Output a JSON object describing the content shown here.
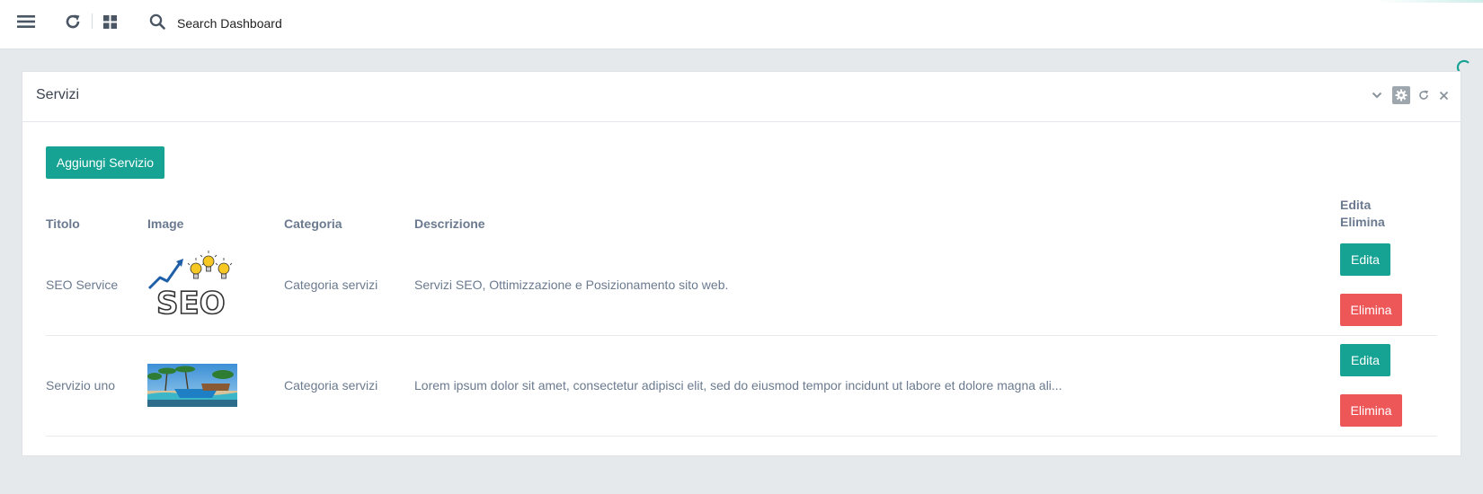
{
  "topbar": {
    "icons": [
      "menu-icon",
      "refresh-icon",
      "grid-icon",
      "search-icon"
    ],
    "search": {
      "placeholder": "Search Dashboard",
      "value": ""
    }
  },
  "panel": {
    "title": "Servizi",
    "tools": [
      "chevron-down-icon",
      "gear-icon",
      "reload-icon",
      "close-icon"
    ],
    "add_button": "Aggiungi Servizio",
    "table": {
      "headers": {
        "title": "Titolo",
        "image": "Image",
        "category": "Categoria",
        "description": "Descrizione",
        "actions_line1": "Edita",
        "actions_line2": "Elimina"
      },
      "rows": [
        {
          "title": "SEO Service",
          "image": "seo-thumbnail",
          "category": "Categoria servizi",
          "description": "Servizi SEO, Ottimizzazione e Posizionamento sito web.",
          "edit": "Edita",
          "delete": "Elimina"
        },
        {
          "title": "Servizio uno",
          "image": "beach-thumbnail",
          "category": "Categoria servizi",
          "description": "Lorem ipsum dolor sit amet, consectetur adipisci elit, sed do eiusmod tempor incidunt ut labore et dolore magna ali...",
          "edit": "Edita",
          "delete": "Elimina"
        }
      ]
    }
  },
  "colors": {
    "primary": "#16a393",
    "danger": "#ee5758",
    "text_muted": "#6b7a8f",
    "background": "#e6e9ec"
  }
}
